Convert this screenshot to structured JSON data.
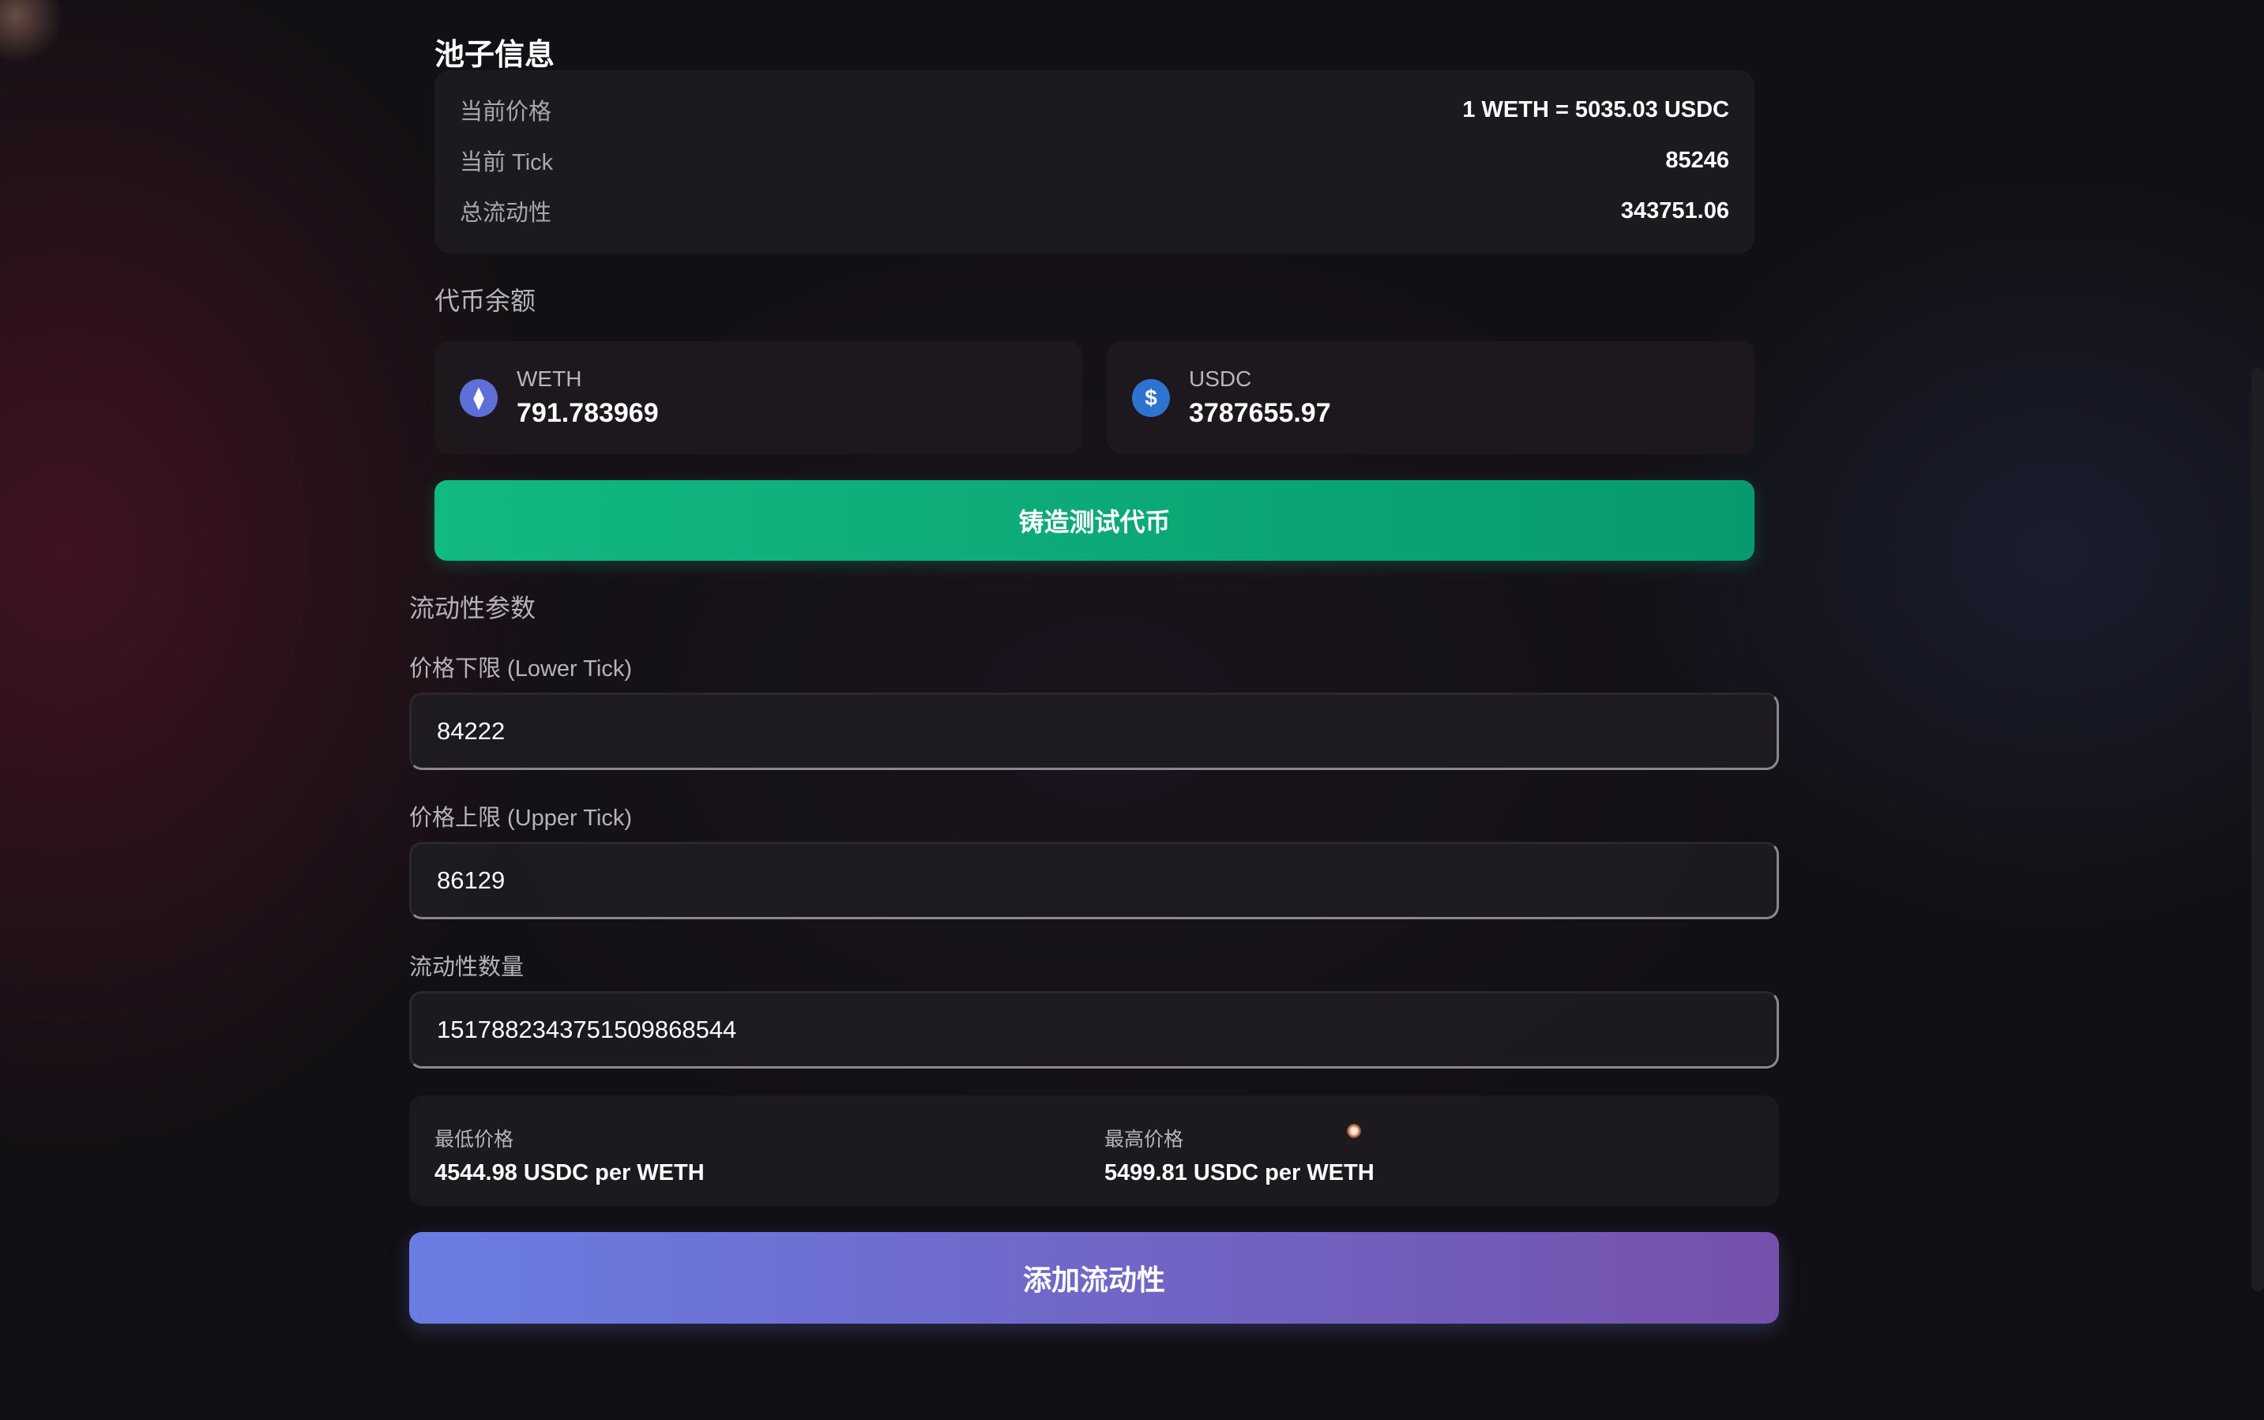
{
  "pool_info": {
    "title": "池子信息",
    "rows": [
      {
        "label": "当前价格",
        "value": "1 WETH = 5035.03 USDC"
      },
      {
        "label": "当前 Tick",
        "value": "85246"
      },
      {
        "label": "总流动性",
        "value": "343751.06"
      }
    ]
  },
  "balances": {
    "title": "代币余额",
    "tokens": [
      {
        "symbol": "WETH",
        "amount": "791.783969",
        "icon": "ethereum-icon",
        "icon_glyph": "⧫",
        "icon_color": "#5f6fd8"
      },
      {
        "symbol": "USDC",
        "amount": "3787655.97",
        "icon": "dollar-icon",
        "icon_glyph": "$",
        "icon_color": "#2f73d1"
      }
    ],
    "mint_label": "铸造测试代币"
  },
  "liquidity": {
    "title": "流动性参数",
    "fields": [
      {
        "label": "价格下限 (Lower Tick)",
        "value": "84222"
      },
      {
        "label": "价格上限 (Upper Tick)",
        "value": "86129"
      },
      {
        "label": "流动性数量",
        "value": "1517882343751509868544"
      }
    ],
    "range": {
      "min_label": "最低价格",
      "min_value": "4544.98 USDC per WETH",
      "max_label": "最高价格",
      "max_value": "5499.81 USDC per WETH"
    },
    "add_label": "添加流动性"
  },
  "colors": {
    "mint_button": "#12b981",
    "add_button_start": "#6a7de3",
    "add_button_end": "#7551ac"
  }
}
